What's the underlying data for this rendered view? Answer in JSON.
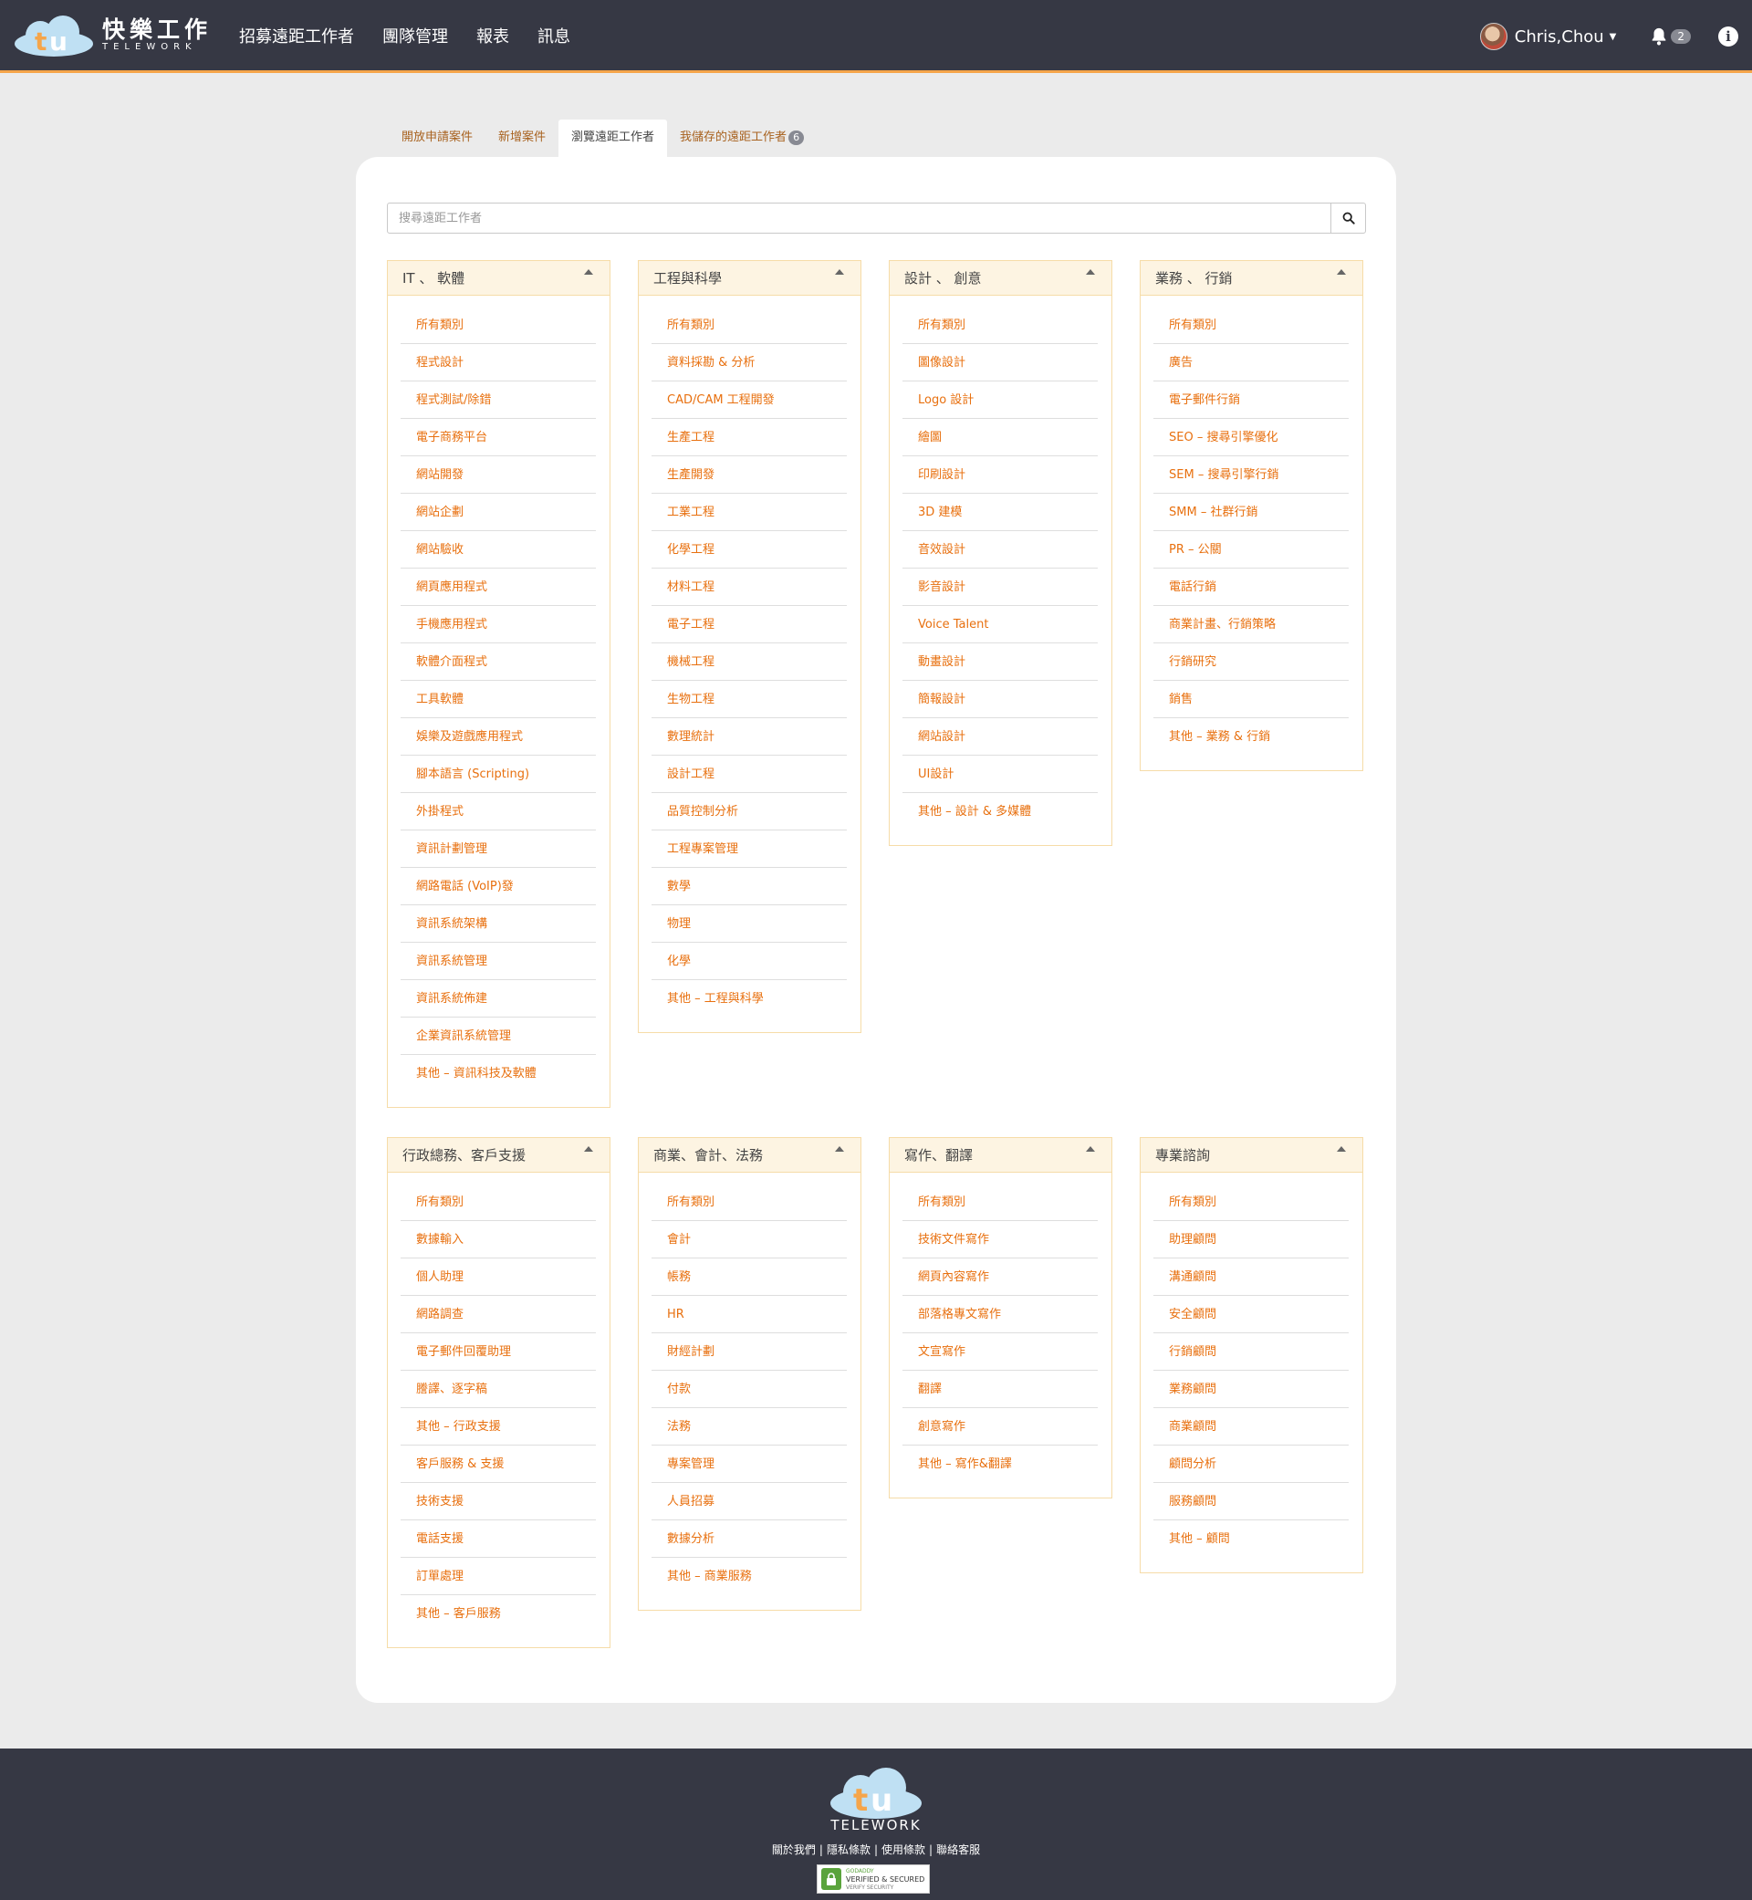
{
  "header": {
    "brand_cn": "快樂工作",
    "brand_en": "TELEWORK",
    "nav": [
      "招募遠距工作者",
      "團隊管理",
      "報表",
      "訊息"
    ],
    "user_name": "Chris,Chou",
    "notifications_count": "2"
  },
  "tabs": [
    {
      "label": "開放申請案件"
    },
    {
      "label": "新增案件"
    },
    {
      "label": "瀏覽遠距工作者"
    },
    {
      "label": "我儲存的遠距工作者",
      "badge": "6"
    }
  ],
  "active_tab_index": 2,
  "search": {
    "placeholder": "搜尋遠距工作者"
  },
  "categories": [
    {
      "title": "IT 、 軟體",
      "items": [
        "所有類別",
        "程式設計",
        "程式測試/除錯",
        "電子商務平台",
        "網站開發",
        "網站企劃",
        "網站驗收",
        "網頁應用程式",
        "手機應用程式",
        "軟體介面程式",
        "工具軟體",
        "娛樂及遊戲應用程式",
        "腳本語言 (Scripting)",
        "外掛程式",
        "資訊計劃管理",
        "網路電話 (VoIP)發",
        "資訊系統架構",
        "資訊系統管理",
        "資訊系統佈建",
        "企業資訊系統管理",
        "其他 – 資訊科技及軟體"
      ]
    },
    {
      "title": "工程與科學",
      "items": [
        "所有類別",
        "資料採勘 & 分析",
        "CAD/CAM 工程開發",
        "生產工程",
        "生產開發",
        "工業工程",
        "化學工程",
        "材料工程",
        "電子工程",
        "機械工程",
        "生物工程",
        "數理統計",
        "設計工程",
        "品質控制分析",
        "工程專案管理",
        "數學",
        "物理",
        "化學",
        "其他 – 工程與科學"
      ]
    },
    {
      "title": "設計 、 創意",
      "items": [
        "所有類別",
        "圖像設計",
        "Logo 設計",
        "繪圖",
        "印刷設計",
        "3D 建模",
        "音效設計",
        "影音設計",
        "Voice Talent",
        "動畫設計",
        "簡報設計",
        "網站設計",
        "UI設計",
        "其他 – 設計 & 多媒體"
      ]
    },
    {
      "title": "業務 、 行銷",
      "items": [
        "所有類別",
        "廣告",
        "電子郵件行銷",
        "SEO – 搜尋引擎優化",
        "SEM – 搜尋引擎行銷",
        "SMM – 社群行銷",
        "PR – 公關",
        "電話行銷",
        "商業計畫、行銷策略",
        "行銷研究",
        "銷售",
        "其他 – 業務 & 行銷"
      ]
    },
    {
      "title": "行政總務、客戶支援",
      "items": [
        "所有類別",
        "數據輸入",
        "個人助理",
        "網路調查",
        "電子郵件回覆助理",
        "謄譯、逐字稿",
        "其他 – 行政支援",
        "客戶服務 & 支援",
        "技術支援",
        "電話支援",
        "訂單處理",
        "其他 – 客戶服務"
      ]
    },
    {
      "title": "商業、會計、法務",
      "items": [
        "所有類別",
        "會計",
        "帳務",
        "HR",
        "財經計劃",
        "付款",
        "法務",
        "專案管理",
        "人員招募",
        "數據分析",
        "其他 – 商業服務"
      ]
    },
    {
      "title": "寫作、翻譯",
      "items": [
        "所有類別",
        "技術文件寫作",
        "網頁內容寫作",
        "部落格專文寫作",
        "文宣寫作",
        "翻譯",
        "創意寫作",
        "其他 – 寫作&翻譯"
      ]
    },
    {
      "title": "專業諮詢",
      "items": [
        "所有類別",
        "助理顧問",
        "溝通顧問",
        "安全顧問",
        "行銷顧問",
        "業務顧問",
        "商業顧問",
        "顧問分析",
        "服務顧問",
        "其他 – 顧問"
      ]
    }
  ],
  "footer": {
    "brand": "TELEWORK",
    "links": [
      "關於我們",
      "隱私條款",
      "使用條款",
      "聯絡客服"
    ],
    "seal": {
      "line1": "GODADDY",
      "line2": "VERIFIED & SECURED",
      "line3": "VERIFY SECURITY"
    }
  },
  "colors": {
    "header_bg": "#363844",
    "accent": "#f5a54a",
    "link": "#e8700f",
    "panel_head": "#fdf4e2"
  }
}
